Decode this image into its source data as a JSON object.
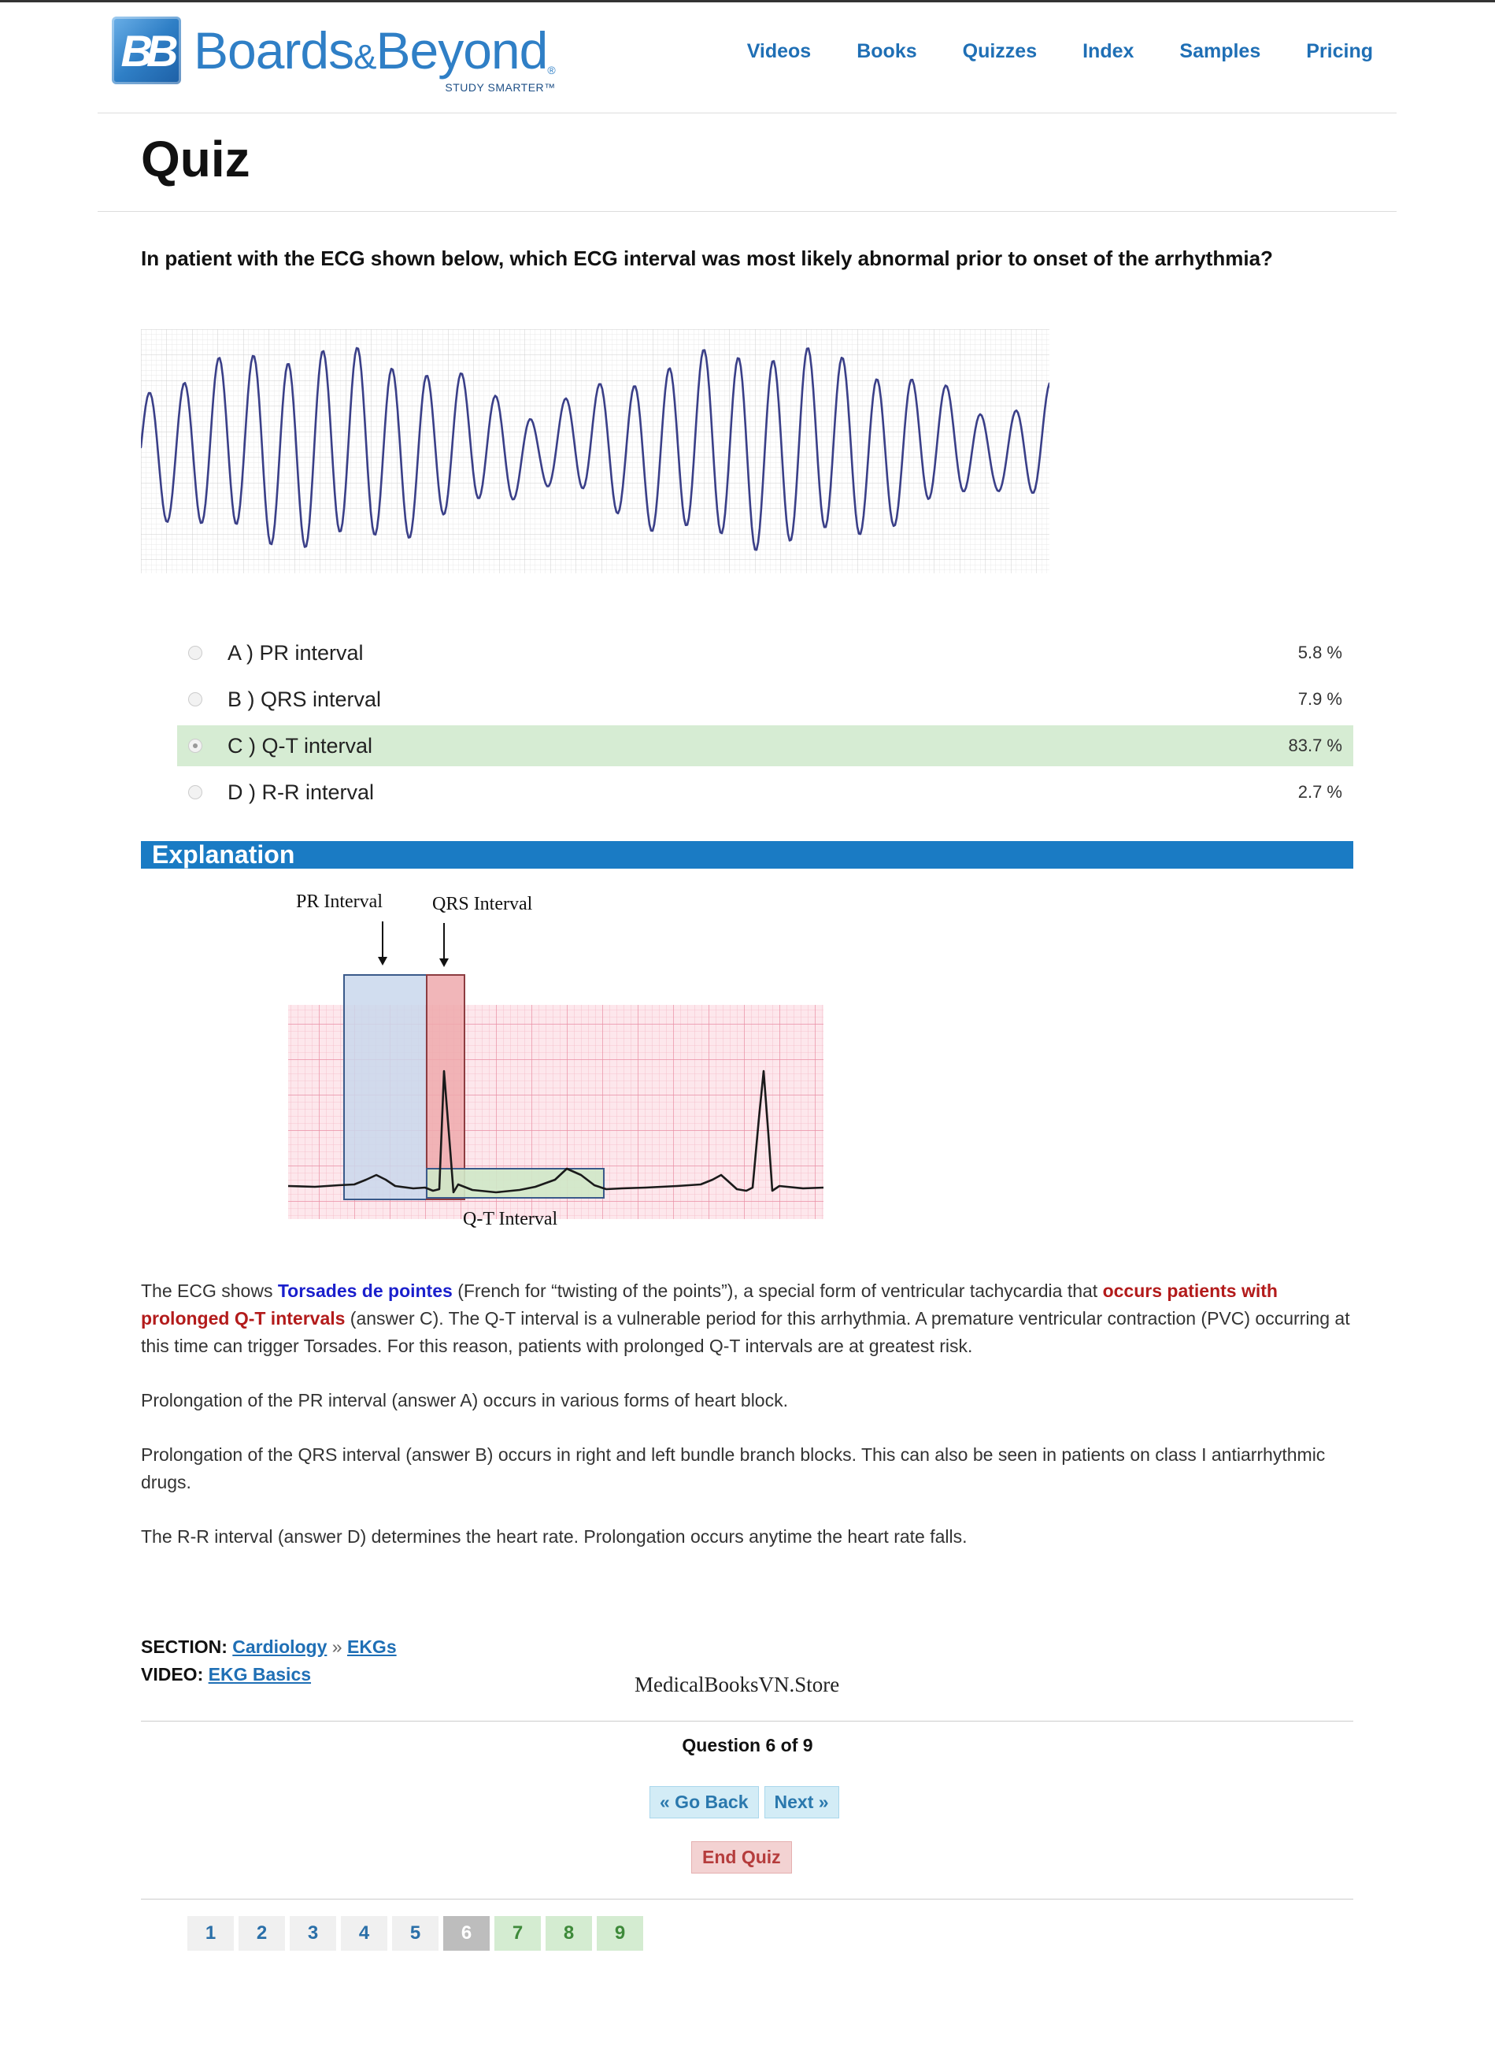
{
  "brand": {
    "name_a": "Boards",
    "amp": "&",
    "name_b": "Beyond",
    "reg": "®",
    "tagline": "STUDY SMARTER™",
    "mark": "BB"
  },
  "nav": [
    "Videos",
    "Books",
    "Quizzes",
    "Index",
    "Samples",
    "Pricing"
  ],
  "page_title": "Quiz",
  "question": "In patient with the ECG shown below, which ECG interval was most likely abnormal prior to onset of the arrhythmia?",
  "answers": [
    {
      "label": "A ) PR interval",
      "pct": "5.8 %"
    },
    {
      "label": "B ) QRS interval",
      "pct": "7.9 %"
    },
    {
      "label": "C ) Q-T interval",
      "pct": "83.7 %",
      "selected": true
    },
    {
      "label": "D ) R-R interval",
      "pct": "2.7 %"
    }
  ],
  "explanation": {
    "heading": "Explanation",
    "diagram": {
      "pr_label": "PR Interval",
      "qrs_label": "QRS Interval",
      "qt_label": "Q-T Interval"
    },
    "p1_a": "The ECG shows ",
    "p1_b": "Torsades de pointes",
    "p1_c": " (French for “twisting of the points”), a special form of ventricular tachycardia that ",
    "p1_d": "occurs patients with prolonged Q-T intervals",
    "p1_e": " (answer C). The Q-T interval is a vulnerable period for this arrhythmia. A premature ventricular contraction (PVC) occurring at this time can trigger Torsades. For this reason, patients with prolonged Q-T intervals are at greatest risk.",
    "p2": "Prolongation of the PR interval (answer A) occurs in various forms of heart block.",
    "p3": "Prolongation of the QRS interval (answer B) occurs in right and left bundle branch blocks. This can also be seen in patients on class I antiarrhythmic drugs.",
    "p4": "The R-R interval (answer D) determines the heart rate. Prolongation occurs anytime the heart rate falls."
  },
  "section": {
    "section_label": "SECTION:",
    "section_link": "Cardiology",
    "sep": "»",
    "sub_link": "EKGs",
    "video_label": "VIDEO:",
    "video_link": "EKG Basics"
  },
  "watermark": "MedicalBooksVN.Store",
  "progress": {
    "text": "Question 6 of 9",
    "current": 6,
    "total": 9
  },
  "buttons": {
    "back": "« Go Back",
    "next": "Next »",
    "end": "End Quiz"
  },
  "pages": [
    "1",
    "2",
    "3",
    "4",
    "5",
    "6",
    "7",
    "8",
    "9"
  ],
  "colors": {
    "brand_blue": "#2f7fc6",
    "nav_blue": "#1f6fb5",
    "selected_bg": "#d6ecd3",
    "explanation_bar": "#1a7bc4",
    "highlight_red": "#b31b1b",
    "highlight_blue": "#1a1fcc"
  }
}
